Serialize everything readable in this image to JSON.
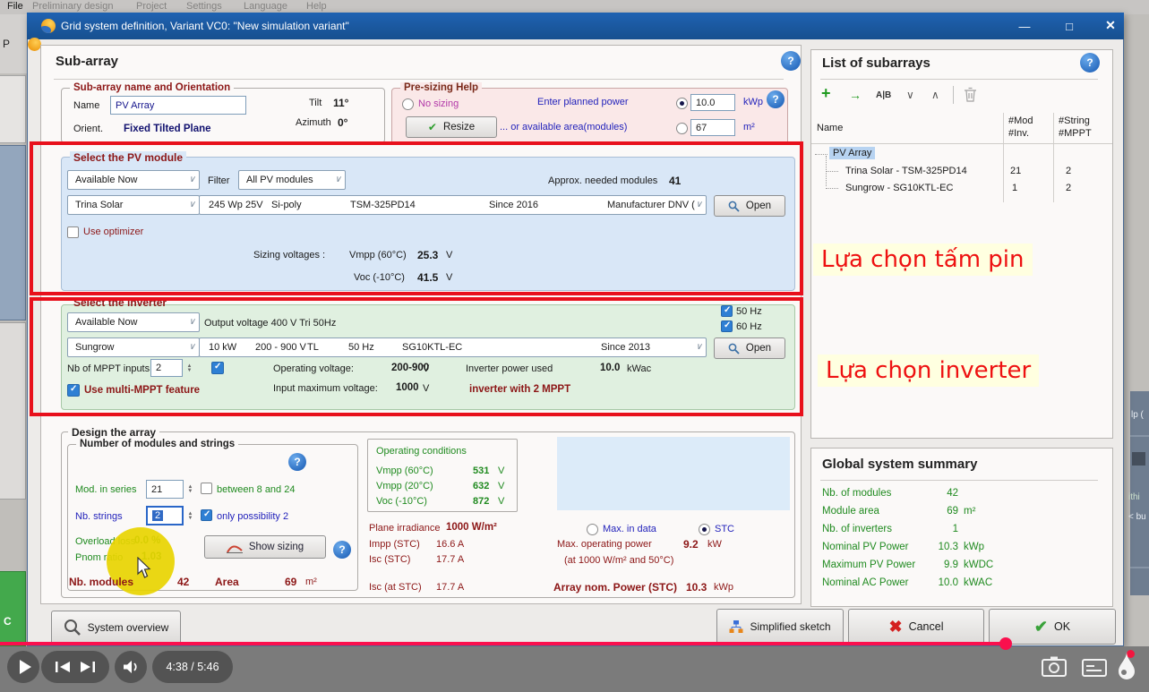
{
  "video": {
    "time_label": "4:38 / 5:46",
    "progress_color": "#fa0f4d"
  },
  "app": {
    "menu_file": "File",
    "menu_items": [
      "Preliminary design",
      "Project",
      "Settings",
      "Language",
      "Help"
    ],
    "left_fragment_p": "P",
    "left_fragment_c": "C",
    "right_fragments": [
      "lp (",
      "ithi",
      "< bu"
    ]
  },
  "glyphs": {
    "check": "✔",
    "cross": "✖",
    "plus": "+",
    "arrow": "→",
    "ab": "A|B",
    "chev_down": "∨",
    "chev_up": "∧",
    "minimize": "—",
    "maximize": "□",
    "close": "✕",
    "question": "?"
  },
  "dialog": {
    "title": "Grid system definition, Variant VC0:   \"New simulation variant\""
  },
  "subarray": {
    "heading": "Sub-array",
    "name_group": {
      "legend": "Sub-array name and Orientation",
      "name_label": "Name",
      "name_value": "PV Array",
      "orient_label": "Orient.",
      "orient_value": "Fixed Tilted Plane",
      "tilt_label": "Tilt",
      "tilt_value": "11°",
      "azimuth_label": "Azimuth",
      "azimuth_value": "0°"
    },
    "presizing": {
      "legend": "Pre-sizing Help",
      "no_sizing": "No sizing",
      "resize": "Resize",
      "planned_label": "Enter planned power",
      "planned_value": "10.0",
      "planned_unit": "kWp",
      "area_label": "... or available area(modules)",
      "area_value": "67",
      "area_unit": "m²"
    }
  },
  "pv_module": {
    "legend": "Select the PV module",
    "availability": "Available Now",
    "filter_label": "Filter",
    "filter_value": "All PV modules",
    "needed_label": "Approx. needed modules",
    "needed_value": "41",
    "manufacturer": "Trina Solar",
    "spec_power": "245 Wp 25V",
    "spec_tech": "Si-poly",
    "spec_model": "TSM-325PD14",
    "spec_since": "Since 2016",
    "spec_source": "Manufacturer DNV (",
    "open": "Open",
    "use_optimizer": "Use optimizer",
    "sizing_label": "Sizing voltages :",
    "vmpp_label": "Vmpp (60°C)",
    "vmpp_value": "25.3",
    "vmpp_unit": "V",
    "voc_label": "Voc (-10°C)",
    "voc_value": "41.5",
    "voc_unit": "V"
  },
  "inverter": {
    "legend": "Select the inverter",
    "availability": "Available Now",
    "output_voltage": "Output voltage 400 V Tri 50Hz",
    "hz50": "50 Hz",
    "hz60": "60 Hz",
    "manufacturer": "Sungrow",
    "spec_power": "10 kW",
    "spec_voltage": "200 - 900 V",
    "spec_tl": "TL",
    "spec_hz": "50 Hz",
    "spec_model": "SG10KTL-EC",
    "spec_since": "Since 2013",
    "open": "Open",
    "mppt_label": "Nb of MPPT inputs",
    "mppt_value": "2",
    "op_voltage_label": "Operating voltage:",
    "op_voltage_value": "200-900",
    "op_voltage_unit": "V",
    "power_used_label": "Inverter power used",
    "power_used_value": "10.0",
    "power_used_unit": "kWac",
    "multi_mppt": "Use multi-MPPT feature",
    "input_max_label": "Input maximum voltage:",
    "input_max_value": "1000",
    "input_max_unit": "V",
    "mppt_note": "inverter with 2 MPPT"
  },
  "design": {
    "legend": "Design the array",
    "mods_legend": "Number of modules and strings",
    "mod_series_label": "Mod. in series",
    "mod_series_value": "21",
    "between_label": "between 8 and 24",
    "strings_label": "Nb. strings",
    "strings_value": "2",
    "only_label": "only possibility 2",
    "overload_label": "Overload loss",
    "overload_value": "0.0 %",
    "pnom_label": "Pnom ratio",
    "pnom_value": "1.03",
    "show_sizing": "Show sizing",
    "nb_modules_label": "Nb. modules",
    "nb_modules_value": "42",
    "area_label": "Area",
    "area_value": "69",
    "area_unit": "m²",
    "operating": {
      "title": "Operating conditions",
      "rows": [
        {
          "label": "Vmpp (60°C)",
          "value": "531",
          "unit": "V"
        },
        {
          "label": "Vmpp (20°C)",
          "value": "632",
          "unit": "V"
        },
        {
          "label": "Voc (-10°C)",
          "value": "872",
          "unit": "V"
        }
      ]
    },
    "irradiance_label": "Plane irradiance",
    "irradiance_value": "1000 W/m²",
    "impp_label": "Impp (STC)",
    "impp_value": "16.6 A",
    "isc_label": "Isc (STC)",
    "isc_value": "17.7 A",
    "isc_at_label": "Isc (at STC)",
    "isc_at_value": "17.7 A",
    "max_in_data": "Max. in data",
    "stc": "STC",
    "max_power_label": "Max. operating power",
    "max_power_value": "9.2",
    "max_power_unit": "kW",
    "max_power_note": "(at 1000 W/m² and 50°C)",
    "array_power_label": "Array nom. Power (STC)",
    "array_power_value": "10.3",
    "array_power_unit": "kWp"
  },
  "footer": {
    "system_overview": "System overview",
    "simplified_sketch": "Simplified sketch",
    "cancel": "Cancel",
    "ok": "OK"
  },
  "subarrays_panel": {
    "title": "List of subarrays",
    "col_name": "Name",
    "col_mod": "#Mod",
    "col_inv": "#Inv.",
    "col_string": "#String",
    "col_mppt": "#MPPT",
    "root": "PV Array",
    "rows": [
      {
        "name": "Trina Solar - TSM-325PD14",
        "mod": "21",
        "string": "2"
      },
      {
        "name": "Sungrow - SG10KTL-EC",
        "mod": "1",
        "string": "2"
      }
    ]
  },
  "summary": {
    "title": "Global system summary",
    "rows": [
      {
        "label": "Nb. of modules",
        "value": "42",
        "unit": ""
      },
      {
        "label": "Module area",
        "value": "69",
        "unit": "m²"
      },
      {
        "label": "Nb. of inverters",
        "value": "1",
        "unit": ""
      },
      {
        "label": "Nominal PV Power",
        "value": "10.3",
        "unit": "kWp"
      },
      {
        "label": "Maximum PV Power",
        "value": "9.9",
        "unit": "kWDC"
      },
      {
        "label": "Nominal AC Power",
        "value": "10.0",
        "unit": "kWAC"
      }
    ]
  },
  "annotations": {
    "pv": "Lựa chọn tấm pin",
    "inverter": "Lựa chọn inverter",
    "box_color": "#e8101c",
    "text_color": "#ee1111",
    "bg_color": "#ffffe0"
  }
}
